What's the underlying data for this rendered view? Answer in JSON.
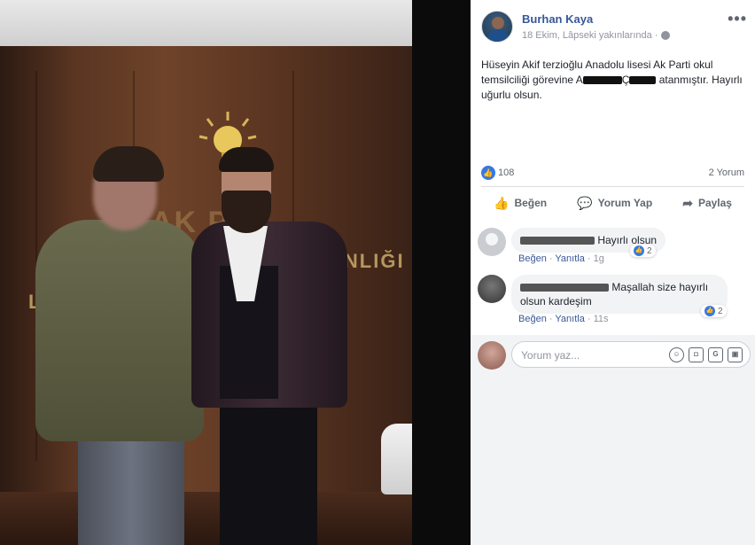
{
  "post": {
    "author": "Burhan Kaya",
    "meta_text": "18 Ekim, Lâpseki yakınlarında ·",
    "text_part1": "Hüseyin Akif terzioğlu Anadolu lisesi Ak Parti okul temsilciliği görevine A",
    "text_part2": "Ç",
    "text_part3": " atanmıştır. Hayırlı uğurlu olsun.",
    "more_label": "•••"
  },
  "stats": {
    "likes": "108",
    "comments": "2 Yorum"
  },
  "actions": {
    "like": "Beğen",
    "comment": "Yorum Yap",
    "share": "Paylaş"
  },
  "comments": [
    {
      "text": "Hayırlı olsun",
      "like_label": "Beğen",
      "reply_label": "Yanıtla",
      "time": "1g",
      "reactions": "2"
    },
    {
      "text": "Maşallah size hayırlı olsun kardeşim",
      "like_label": "Beğen",
      "reply_label": "Yanıtla",
      "time": "11s",
      "reactions": "2"
    }
  ],
  "compose": {
    "placeholder": "Yorum yaz..."
  },
  "photo": {
    "sign_left": "L",
    "sign_right": "ANLIĞI",
    "sign_top": "AK P  LI"
  },
  "colors": {
    "link": "#365899",
    "like_blue": "#3578e5",
    "muted": "#90949c"
  }
}
